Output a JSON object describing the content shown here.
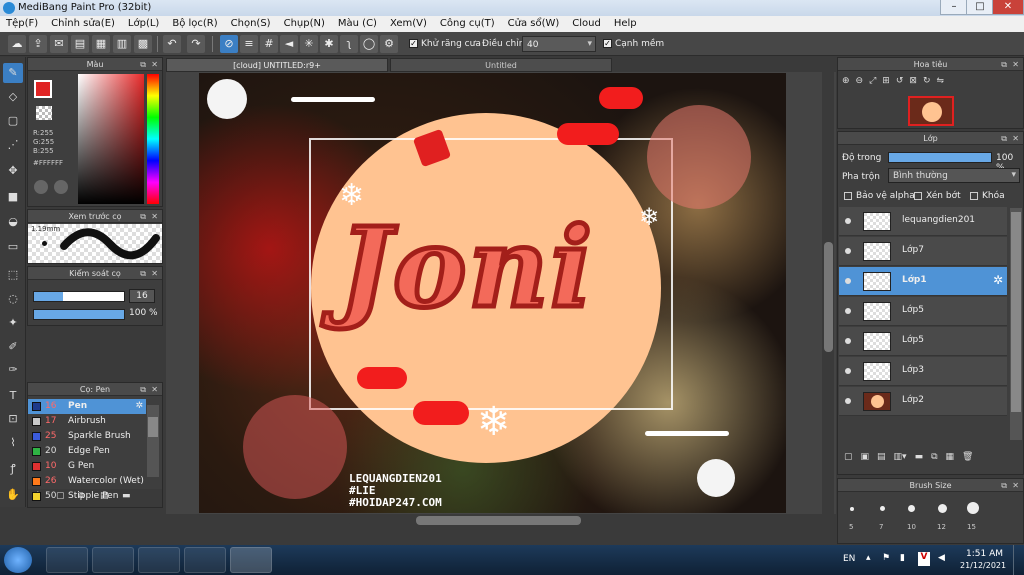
{
  "titlebar": {
    "title": "MediBang Paint Pro (32bit)"
  },
  "menubar": {
    "items": [
      "Tệp(F)",
      "Chỉnh sửa(E)",
      "Lớp(L)",
      "Bộ lọc(R)",
      "Chọn(S)",
      "Chụp(N)",
      "Màu (C)",
      "Xem(V)",
      "Công cụ(T)",
      "Cửa sổ(W)",
      "Cloud",
      "Help"
    ]
  },
  "toolbar": {
    "antialias_label": "Khử răng cưa",
    "correction_label": "Điều chỉnh",
    "correction_value": "40",
    "sharp_edge_label": "Cạnh mềm"
  },
  "color_panel": {
    "title": "Màu",
    "r": "R:255",
    "g": "G:255",
    "b": "B:255",
    "hex": "#FFFFFF"
  },
  "brush_preview": {
    "title": "Xem trước cọ",
    "size": "1.19mm"
  },
  "brush_control": {
    "title": "Kiểm soát cọ",
    "size_value": "16",
    "opacity_value": "100 %"
  },
  "brush_list": {
    "title": "Cọ: Pen",
    "items": [
      {
        "num": "16",
        "name": "Pen",
        "color": "#1e3a8a"
      },
      {
        "num": "17",
        "name": "Airbrush",
        "color": "#c8c8c8"
      },
      {
        "num": "25",
        "name": "Sparkle Brush",
        "color": "#3b5bdb"
      },
      {
        "num": "20",
        "name": "Edge Pen",
        "color": "#2fb344"
      },
      {
        "num": "10",
        "name": "G Pen",
        "color": "#e03131"
      },
      {
        "num": "26",
        "name": "Watercolor (Wet)",
        "color": "#ff7a1a"
      },
      {
        "num": "50",
        "name": "Stipple Pen",
        "color": "#f2d22e"
      }
    ]
  },
  "tabs": [
    "[cloud] UNTITLED:r9+",
    "Untitled"
  ],
  "canvas": {
    "main_text": "Joni",
    "watermark1": "LEQUANGDIEN201",
    "watermark2": "#LIE",
    "watermark3": "#HOIDAP247.COM"
  },
  "navigator": {
    "title": "Hoa tiêu"
  },
  "layer_panel": {
    "title": "Lớp",
    "opacity_label": "Độ trong",
    "opacity_value": "100 %",
    "blend_label": "Pha trộn",
    "blend_value": "Bình thường",
    "protect_alpha": "Bảo vệ alpha",
    "clip": "Xén bớt",
    "lock": "Khóa",
    "layers": [
      "lequangdien201",
      "Lớp7",
      "Lớp1",
      "Lớp5",
      "Lớp5",
      "Lớp3",
      "Lớp2"
    ]
  },
  "brush_size": {
    "title": "Brush Size",
    "sizes": [
      "5",
      "7",
      "10",
      "12",
      "15"
    ]
  },
  "taskbar": {
    "lang": "EN",
    "time": "1:51 AM",
    "date": "21/12/2021"
  },
  "colors": {
    "accent": "#4f93d6",
    "circle": "#ffc391",
    "text_red": "#b8241a"
  }
}
